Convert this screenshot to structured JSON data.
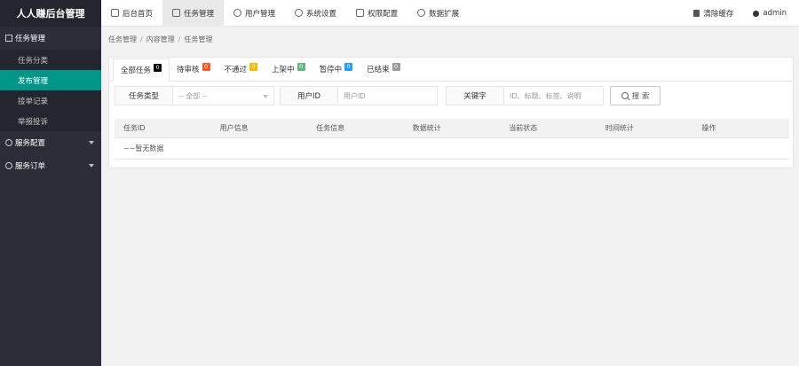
{
  "app": {
    "title": "人人赚后台管理"
  },
  "topnav": [
    {
      "label": "后台首页",
      "icon": "home-icon",
      "active": false
    },
    {
      "label": "任务管理",
      "icon": "task-icon",
      "active": true
    },
    {
      "label": "用户管理",
      "icon": "user-icon",
      "active": false
    },
    {
      "label": "系统设置",
      "icon": "gear-icon",
      "active": false
    },
    {
      "label": "权限配置",
      "icon": "lock-icon",
      "active": false
    },
    {
      "label": "数据扩展",
      "icon": "diamond-icon",
      "active": false
    }
  ],
  "topright": {
    "clear_cache": "清除缓存",
    "user": "admin"
  },
  "sidebar": {
    "group1": "任务管理",
    "items": [
      "任务分类",
      "发布管理",
      "接单记录",
      "举报投诉"
    ],
    "group2": "服务配置",
    "group3": "服务订单"
  },
  "breadcrumb": [
    "任务管理",
    "内容管理",
    "任务管理"
  ],
  "tabs": [
    {
      "label": "全部任务",
      "count": "0",
      "color": "#000000"
    },
    {
      "label": "待审核",
      "count": "0",
      "color": "#FF5722"
    },
    {
      "label": "不通过",
      "count": "0",
      "color": "#FFB800"
    },
    {
      "label": "上架中",
      "count": "0",
      "color": "#5FB878"
    },
    {
      "label": "暂停中",
      "count": "0",
      "color": "#1E9FFF"
    },
    {
      "label": "已结束",
      "count": "0",
      "color": "#999999"
    }
  ],
  "filters": {
    "type_label": "任务类型",
    "type_value": "-- 全部 --",
    "uid_label": "用户ID",
    "uid_placeholder": "用户ID",
    "kw_label": "关键字",
    "kw_placeholder": "ID、标题、标签、说明",
    "search_label": "搜 索"
  },
  "table": {
    "columns": [
      "任务ID",
      "用户信息",
      "任务信息",
      "数据统计",
      "当前状态",
      "时间统计",
      "操作"
    ],
    "empty_text": "~~暂无数据"
  },
  "colors": {
    "accent": "#009688",
    "sidebar": "#2b2e37",
    "logo_bg": "#23262e"
  }
}
